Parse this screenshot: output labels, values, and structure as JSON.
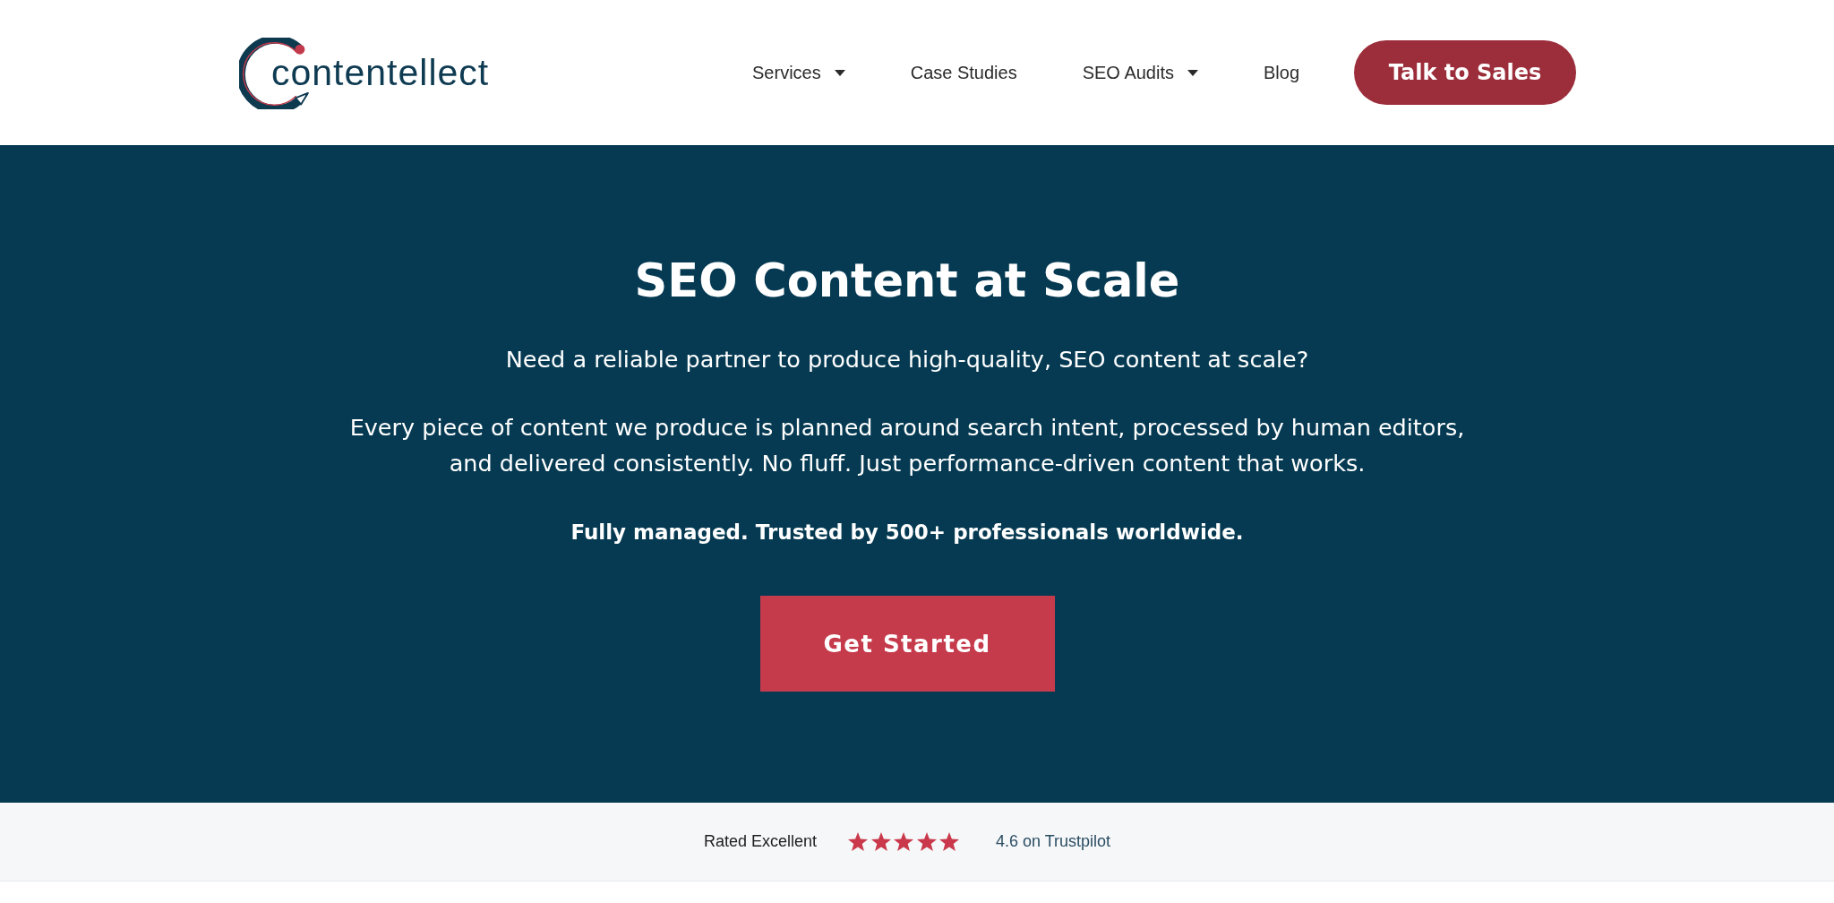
{
  "header": {
    "logo": {
      "text": "contentellect"
    },
    "nav": [
      {
        "label": "Services",
        "dropdown": true
      },
      {
        "label": "Case Studies",
        "dropdown": false
      },
      {
        "label": "SEO Audits",
        "dropdown": true
      },
      {
        "label": "Blog",
        "dropdown": false
      }
    ],
    "cta": {
      "label": "Talk to Sales"
    }
  },
  "hero": {
    "title": "SEO Content at Scale",
    "subtitle": "Need a reliable partner to produce high-quality, SEO content at scale?",
    "description": "Every piece of content we produce is planned around search intent, processed by human editors, and delivered consistently. No fluff. Just performance-driven content that works.",
    "tagline": "Fully managed. Trusted by 500+ professionals worldwide.",
    "button": {
      "label": "Get Started"
    }
  },
  "rating_bar": {
    "label": "Rated Excellent",
    "stars": 5,
    "score": "4.6 on Trustpilot"
  }
}
